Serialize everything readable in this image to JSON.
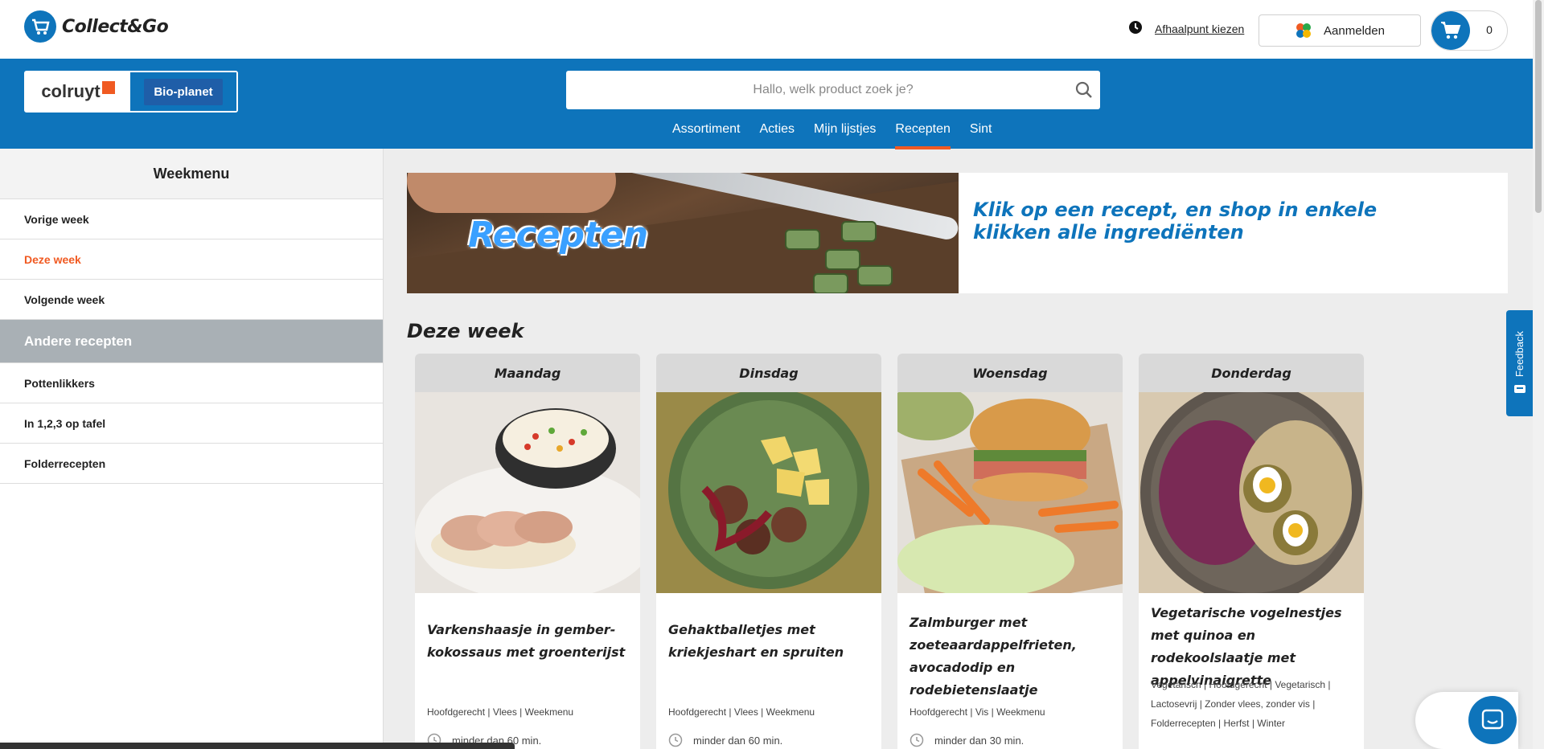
{
  "header": {
    "logo_text": "Collect&Go",
    "pickup_label": "Afhaalpunt kiezen",
    "login_label": "Aanmelden",
    "cart_count": "0"
  },
  "brands": {
    "colruyt": "colruyt",
    "bioplanet": "Bio-planet"
  },
  "search": {
    "placeholder": "Hallo, welk product zoek je?"
  },
  "nav": [
    {
      "label": "Assortiment"
    },
    {
      "label": "Acties"
    },
    {
      "label": "Mijn lijstjes"
    },
    {
      "label": "Recepten",
      "active": true
    },
    {
      "label": "Sint"
    }
  ],
  "sidebar": {
    "title": "Weekmenu",
    "items": [
      {
        "label": "Vorige week"
      },
      {
        "label": "Deze week",
        "state": "selected"
      },
      {
        "label": "Volgende week"
      },
      {
        "label": "Andere recepten",
        "state": "section"
      },
      {
        "label": "Pottenlikkers"
      },
      {
        "label": "In 1,2,3 op tafel"
      },
      {
        "label": "Folderrecepten"
      }
    ]
  },
  "banner": {
    "word": "Recepten",
    "text": "Klik op een recept, en shop in enkele klikken alle ingrediënten"
  },
  "section_title": "Deze week",
  "cards": [
    {
      "day": "Maandag",
      "title": "Varkenshaasje in gember-kokossaus met groenterijst",
      "tags": "Hoofdgerecht | Vlees | Weekmenu",
      "time": "minder dan 60 min."
    },
    {
      "day": "Dinsdag",
      "title": "Gehaktballetjes met kriekjeshart en spruiten",
      "tags": "Hoofdgerecht | Vlees | Weekmenu",
      "time": "minder dan 60 min."
    },
    {
      "day": "Woensdag",
      "title": "Zalmburger met zoeteaardappelfrieten, avocadodip en rodebietenslaatje",
      "tags": "Hoofdgerecht | Vis | Weekmenu",
      "time": "minder dan 30 min."
    },
    {
      "day": "Donderdag",
      "title": "Vegetarische vogelnestjes met quinoa en rodekoolslaatje met appelvinaigrette",
      "tags": "Vegetarisch | Hoofdgerecht | Vegetarisch | Lactosevrij | Zonder vlees, zonder vis | Folderrecepten | Herfst | Winter",
      "time": ""
    }
  ],
  "feedback_label": "Feedback",
  "colors": {
    "brand_blue": "#0e74bb",
    "accent_orange": "#f05a22",
    "sidebar_section": "#a9b0b5"
  },
  "icons": [
    "collectgo-logo-icon",
    "clock-icon",
    "google-icon",
    "cart-icon",
    "search-icon",
    "time-icon",
    "chat-icon"
  ]
}
